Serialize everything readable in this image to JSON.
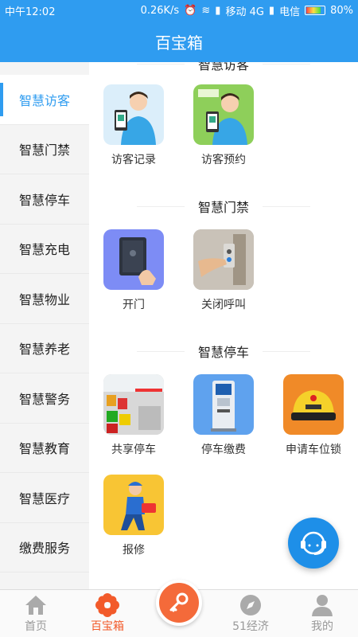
{
  "statusbar": {
    "time": "中午12:02",
    "speed": "0.26K/s",
    "carrier1": "移动 4G",
    "carrier2": "电信",
    "battery": "80%"
  },
  "header": {
    "title": "百宝箱"
  },
  "sidebar": {
    "items": [
      {
        "label": "智慧访客"
      },
      {
        "label": "智慧门禁"
      },
      {
        "label": "智慧停车"
      },
      {
        "label": "智慧充电"
      },
      {
        "label": "智慧物业"
      },
      {
        "label": "智慧养老"
      },
      {
        "label": "智慧警务"
      },
      {
        "label": "智慧教育"
      },
      {
        "label": "智慧医疗"
      },
      {
        "label": "缴费服务"
      }
    ]
  },
  "sections": [
    {
      "title": "智慧访客",
      "tiles": [
        {
          "label": "访客记录",
          "icon": "visitor-record-icon"
        },
        {
          "label": "访客预约",
          "icon": "visitor-appointment-icon"
        }
      ]
    },
    {
      "title": "智慧门禁",
      "tiles": [
        {
          "label": "开门",
          "icon": "door-card-icon"
        },
        {
          "label": "关闭呼叫",
          "icon": "doorbell-icon"
        }
      ]
    },
    {
      "title": "智慧停车",
      "tiles": [
        {
          "label": "共享停车",
          "icon": "parking-lot-icon"
        },
        {
          "label": "停车缴费",
          "icon": "parking-kiosk-icon"
        },
        {
          "label": "申请车位锁",
          "icon": "parking-lock-icon"
        },
        {
          "label": "报修",
          "icon": "repair-worker-icon"
        }
      ]
    }
  ],
  "tabbar": {
    "tabs": [
      {
        "label": "首页",
        "icon": "home-icon"
      },
      {
        "label": "百宝箱",
        "icon": "flower-icon"
      },
      {
        "label": "",
        "icon": "key-icon"
      },
      {
        "label": "51经济",
        "icon": "compass-icon"
      },
      {
        "label": "我的",
        "icon": "person-icon"
      }
    ],
    "active_index": 1
  },
  "colors": {
    "brand": "#2f9cf0",
    "tab_active": "#f25a2a",
    "center_button": "#f46a3a"
  }
}
